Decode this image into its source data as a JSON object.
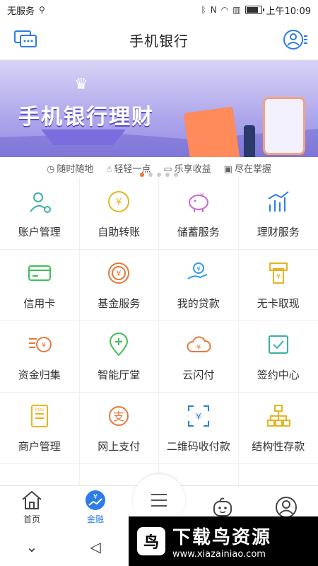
{
  "status_bar": {
    "carrier": "无服务",
    "time": "上午10:09",
    "battery_percent": 85
  },
  "header": {
    "title": "手机银行"
  },
  "banner": {
    "title": "手机银行理财",
    "features": [
      {
        "icon": "clock-icon",
        "label": "随时随地"
      },
      {
        "icon": "tap-icon",
        "label": "轻轻一点"
      },
      {
        "icon": "wallet-icon",
        "label": "乐享收益"
      },
      {
        "icon": "briefcase-icon",
        "label": "尽在掌握"
      }
    ],
    "slides_total": 5,
    "active_slide": 1
  },
  "services": [
    {
      "label": "账户管理",
      "icon": "account-icon",
      "color": "#3bb0a5"
    },
    {
      "label": "自助转账",
      "icon": "transfer-icon",
      "color": "#e6b422"
    },
    {
      "label": "储蓄服务",
      "icon": "piggy-bank-icon",
      "color": "#c86ad1"
    },
    {
      "label": "理财服务",
      "icon": "chart-icon",
      "color": "#2c7de6"
    },
    {
      "label": "信用卡",
      "icon": "credit-card-icon",
      "color": "#3fbf57"
    },
    {
      "label": "基金服务",
      "icon": "fund-icon",
      "color": "#e57a3a"
    },
    {
      "label": "我的贷款",
      "icon": "loan-icon",
      "color": "#2c9ae6"
    },
    {
      "label": "无卡取现",
      "icon": "cash-icon",
      "color": "#e6b422"
    },
    {
      "label": "资金归集",
      "icon": "collect-icon",
      "color": "#e57a3a"
    },
    {
      "label": "智能厅堂",
      "icon": "location-icon",
      "color": "#3fbf57"
    },
    {
      "label": "云闪付",
      "icon": "cloud-pay-icon",
      "color": "#e57a3a"
    },
    {
      "label": "签约中心",
      "icon": "sign-icon",
      "color": "#3bb0a5"
    },
    {
      "label": "商户管理",
      "icon": "pos-icon",
      "color": "#e6b422"
    },
    {
      "label": "网上支付",
      "icon": "online-pay-icon",
      "color": "#e57a3a"
    },
    {
      "label": "二维码收付款",
      "icon": "qr-icon",
      "color": "#2c7de6"
    },
    {
      "label": "结构性存款",
      "icon": "structure-icon",
      "color": "#e6b422"
    },
    {
      "label": "",
      "icon": "more-1-icon",
      "color": "#2c7de6"
    },
    {
      "label": "",
      "icon": "more-2-icon",
      "color": "#e57a3a"
    },
    {
      "label": "",
      "icon": "more-3-icon",
      "color": "#2c7de6"
    },
    {
      "label": "",
      "icon": "more-4-icon",
      "color": "#999999"
    }
  ],
  "bottom_nav": [
    {
      "label": "首页",
      "icon": "home-icon"
    },
    {
      "label": "金融",
      "icon": "finance-icon",
      "active": true
    },
    {
      "label": "",
      "icon": "menu-icon"
    },
    {
      "label": "",
      "icon": "robot-icon"
    },
    {
      "label": "",
      "icon": "profile-icon"
    }
  ],
  "watermark": {
    "title": "下载鸟资源",
    "url": "www.xiazainiao.com"
  },
  "colors": {
    "accent": "#2c7de6",
    "banner_bg": "#a9a1ea",
    "dot_active": "#f4743b"
  }
}
